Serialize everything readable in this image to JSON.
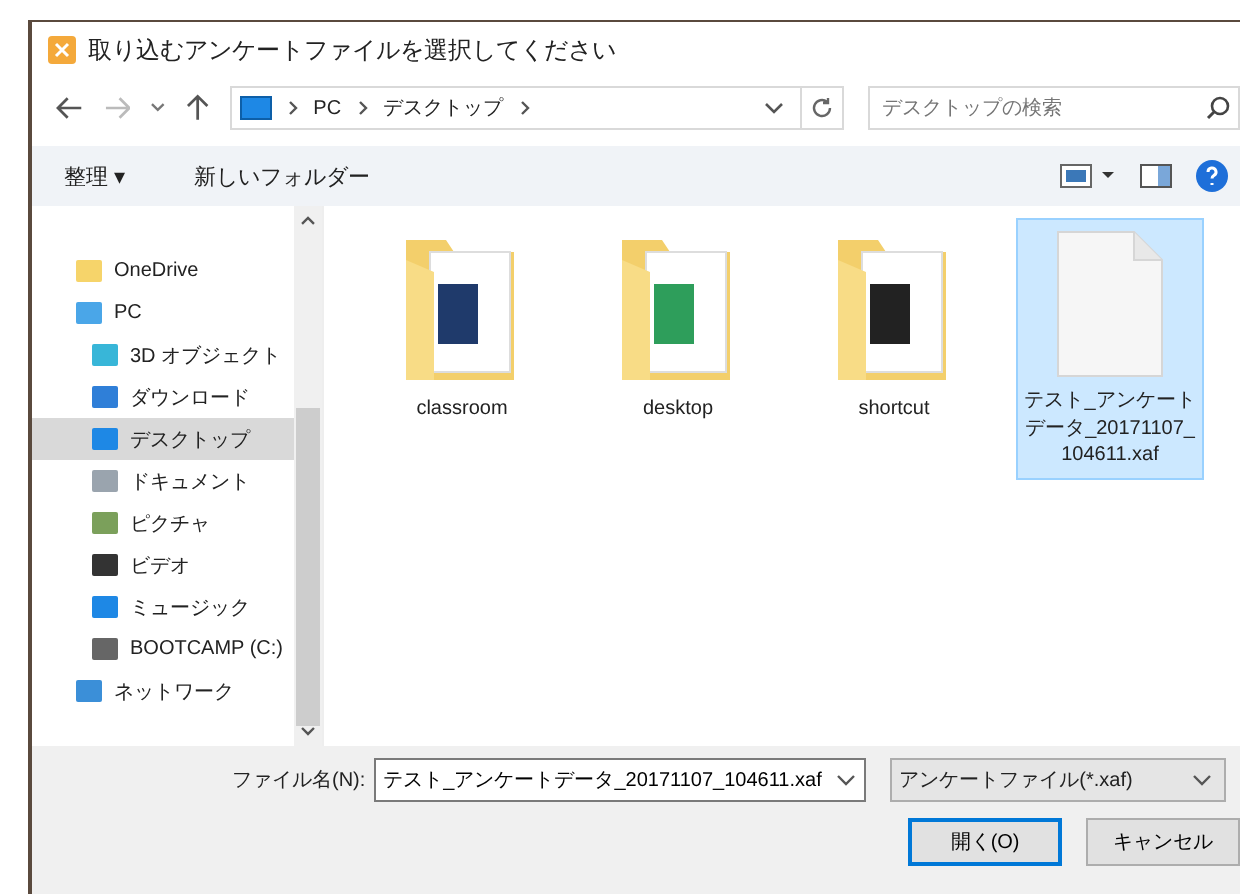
{
  "window": {
    "title": "取り込むアンケートファイルを選択してください"
  },
  "address": {
    "path": [
      {
        "label": "PC"
      },
      {
        "label": "デスクトップ"
      }
    ],
    "search_placeholder": "デスクトップの検索"
  },
  "toolbar": {
    "organize": "整理 ▾",
    "new_folder": "新しいフォルダー"
  },
  "nav": [
    {
      "label": "OneDrive",
      "kind": "cloud",
      "selected": false
    },
    {
      "label": "PC",
      "kind": "pc",
      "selected": false,
      "children": [
        {
          "label": "3D オブジェクト",
          "kind": "objects",
          "selected": false
        },
        {
          "label": "ダウンロード",
          "kind": "downloads",
          "selected": false
        },
        {
          "label": "デスクトップ",
          "kind": "desktop",
          "selected": true
        },
        {
          "label": "ドキュメント",
          "kind": "documents",
          "selected": false
        },
        {
          "label": "ピクチャ",
          "kind": "pictures",
          "selected": false
        },
        {
          "label": "ビデオ",
          "kind": "videos",
          "selected": false
        },
        {
          "label": "ミュージック",
          "kind": "music",
          "selected": false
        },
        {
          "label": "BOOTCAMP (C:)",
          "kind": "drive",
          "selected": false
        }
      ]
    },
    {
      "label": "ネットワーク",
      "kind": "network",
      "selected": false
    }
  ],
  "files": [
    {
      "name": "classroom",
      "kind": "folder",
      "selected": false
    },
    {
      "name": "desktop",
      "kind": "folder",
      "selected": false
    },
    {
      "name": "shortcut",
      "kind": "folder",
      "selected": false
    },
    {
      "name": "テスト_アンケートデータ_20171107_104611.xaf",
      "kind": "file",
      "selected": true
    }
  ],
  "footer": {
    "filename_label": "ファイル名(N):",
    "filename": "テスト_アンケートデータ_20171107_104611.xaf",
    "filter": "アンケートファイル(*.xaf)",
    "open": "開く(O)",
    "cancel": "キャンセル"
  }
}
